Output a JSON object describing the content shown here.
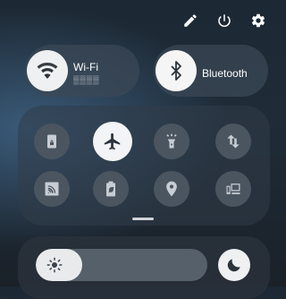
{
  "top_actions": [
    {
      "icon": "edit-icon"
    },
    {
      "icon": "power-icon"
    },
    {
      "icon": "settings-icon"
    }
  ],
  "tiles": {
    "wifi": {
      "label": "Wi-Fi",
      "sub_label": "▒▒▒▒",
      "icon": "wifi-icon"
    },
    "bluetooth": {
      "label": "Bluetooth",
      "icon": "bluetooth-icon"
    }
  },
  "quick_toggles": [
    {
      "icon": "screenshot-icon",
      "state": "off"
    },
    {
      "icon": "airplane-icon",
      "state": "on"
    },
    {
      "icon": "flashlight-icon",
      "state": "off"
    },
    {
      "icon": "mobile-data-icon",
      "state": "off"
    },
    {
      "icon": "cast-icon",
      "state": "off"
    },
    {
      "icon": "battery-saver-icon",
      "state": "off"
    },
    {
      "icon": "location-icon",
      "state": "off"
    },
    {
      "icon": "device-connect-icon",
      "state": "off"
    }
  ],
  "brightness": {
    "level_fraction": 0.27,
    "icon": "sun-icon"
  },
  "night_mode": {
    "icon": "moon-icon",
    "state": "on"
  },
  "colors": {
    "accent_on": "#f3f4f5",
    "toggle_off": "#4a5560"
  }
}
